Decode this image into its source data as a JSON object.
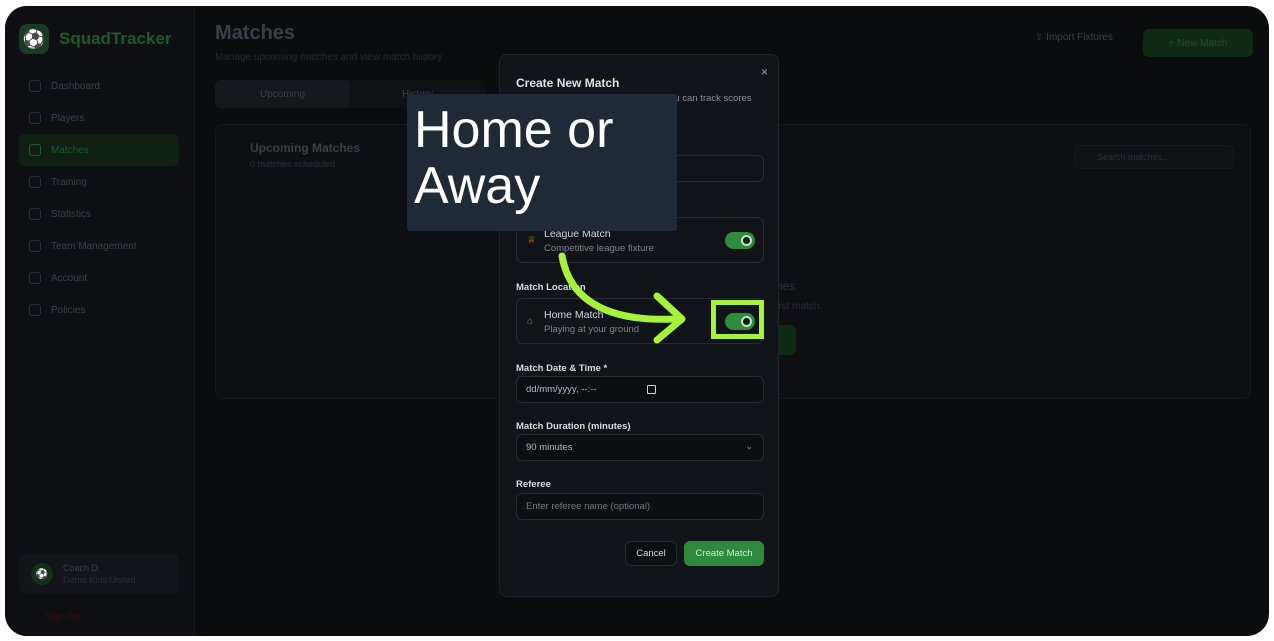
{
  "app": {
    "name": "SquadTracker",
    "logo_icon": "soccer-ball-icon"
  },
  "sidebar": {
    "items": [
      {
        "label": "Dashboard",
        "icon": "home-icon",
        "active": false
      },
      {
        "label": "Players",
        "icon": "users-icon",
        "active": false
      },
      {
        "label": "Matches",
        "icon": "trophy-icon",
        "active": true
      },
      {
        "label": "Training",
        "icon": "dumbbell-icon",
        "active": false
      },
      {
        "label": "Statistics",
        "icon": "bar-chart-icon",
        "active": false
      },
      {
        "label": "Team Management",
        "icon": "user-cog-icon",
        "active": false
      },
      {
        "label": "Account",
        "icon": "user-icon",
        "active": false
      },
      {
        "label": "Policies",
        "icon": "file-icon",
        "active": false
      }
    ],
    "user": {
      "name": "Coach D.",
      "team": "Demo Kids United"
    },
    "sign_out": "Sign Out"
  },
  "header": {
    "title": "Matches",
    "subtitle": "Manage upcoming matches and view match history",
    "import_label": "Import Fixtures",
    "new_match_label": "+ New Match"
  },
  "tabs": [
    {
      "label": "Upcoming"
    },
    {
      "label": "History"
    }
  ],
  "panel": {
    "title": "Upcoming Matches",
    "subtitle": "0 matches scheduled",
    "search_placeholder": "Search matches...",
    "empty_title": "hes",
    "empty_sub": "irst match."
  },
  "modal": {
    "title": "Create New Match",
    "description": "Set up a new match for your team. You can track scores",
    "close": "×",
    "league": {
      "title": "League Match",
      "subtitle": "Competitive league fixture",
      "enabled": true
    },
    "location_label": "Match Location",
    "home": {
      "title": "Home Match",
      "subtitle": "Playing at your ground",
      "enabled": true
    },
    "datetime_label": "Match Date & Time *",
    "datetime_value": "dd/mm/yyyy, --:--",
    "duration_label": "Match Duration (minutes)",
    "duration_value": "90 minutes",
    "referee_label": "Referee",
    "referee_placeholder": "Enter referee name (optional)",
    "cancel_label": "Cancel",
    "create_label": "Create Match"
  },
  "annotation": {
    "text_line1": "Home or",
    "text_line2": "Away",
    "highlight_color": "#a7f23a"
  }
}
